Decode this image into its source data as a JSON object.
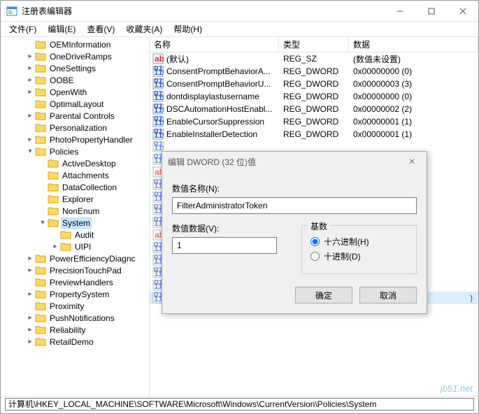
{
  "window": {
    "title": "注册表编辑器"
  },
  "menu": {
    "file": "文件(F)",
    "edit": "编辑(E)",
    "view": "查看(V)",
    "fav": "收藏夹(A)",
    "help": "帮助(H)"
  },
  "tree": [
    {
      "indent": 2,
      "label": "OEMInformation",
      "exp": ""
    },
    {
      "indent": 2,
      "label": "OneDriveRamps",
      "exp": ">"
    },
    {
      "indent": 2,
      "label": "OneSettings",
      "exp": ">"
    },
    {
      "indent": 2,
      "label": "OOBE",
      "exp": ">"
    },
    {
      "indent": 2,
      "label": "OpenWith",
      "exp": ">"
    },
    {
      "indent": 2,
      "label": "OptimalLayout",
      "exp": ""
    },
    {
      "indent": 2,
      "label": "Parental Controls",
      "exp": ">"
    },
    {
      "indent": 2,
      "label": "Personalization",
      "exp": ""
    },
    {
      "indent": 2,
      "label": "PhotoPropertyHandler",
      "exp": ">"
    },
    {
      "indent": 2,
      "label": "Policies",
      "exp": "v"
    },
    {
      "indent": 3,
      "label": "ActiveDesktop",
      "exp": ""
    },
    {
      "indent": 3,
      "label": "Attachments",
      "exp": ""
    },
    {
      "indent": 3,
      "label": "DataCollection",
      "exp": ""
    },
    {
      "indent": 3,
      "label": "Explorer",
      "exp": ""
    },
    {
      "indent": 3,
      "label": "NonEnum",
      "exp": ""
    },
    {
      "indent": 3,
      "label": "System",
      "exp": "v",
      "selected": true
    },
    {
      "indent": 4,
      "label": "Audit",
      "exp": ""
    },
    {
      "indent": 4,
      "label": "UIPI",
      "exp": ">"
    },
    {
      "indent": 2,
      "label": "PowerEfficiencyDiagnc",
      "exp": ">"
    },
    {
      "indent": 2,
      "label": "PrecisionTouchPad",
      "exp": ">"
    },
    {
      "indent": 2,
      "label": "PreviewHandlers",
      "exp": ""
    },
    {
      "indent": 2,
      "label": "PropertySystem",
      "exp": ">"
    },
    {
      "indent": 2,
      "label": "Proximity",
      "exp": ""
    },
    {
      "indent": 2,
      "label": "PushNotifications",
      "exp": ">"
    },
    {
      "indent": 2,
      "label": "Reliability",
      "exp": ">"
    },
    {
      "indent": 2,
      "label": "RetailDemo",
      "exp": ">"
    }
  ],
  "list": {
    "headers": {
      "name": "名称",
      "type": "类型",
      "data": "数据"
    },
    "rows": [
      {
        "icon": "sz",
        "name": "(默认)",
        "type": "REG_SZ",
        "data": "(数值未设置)"
      },
      {
        "icon": "dw",
        "name": "ConsentPromptBehaviorA...",
        "type": "REG_DWORD",
        "data": "0x00000000 (0)"
      },
      {
        "icon": "dw",
        "name": "ConsentPromptBehaviorU...",
        "type": "REG_DWORD",
        "data": "0x00000003 (3)"
      },
      {
        "icon": "dw",
        "name": "dontdisplaylastusername",
        "type": "REG_DWORD",
        "data": "0x00000000 (0)"
      },
      {
        "icon": "dw",
        "name": "DSCAutomationHostEnabl...",
        "type": "REG_DWORD",
        "data": "0x00000002 (2)"
      },
      {
        "icon": "dw",
        "name": "EnableCursorSuppression",
        "type": "REG_DWORD",
        "data": "0x00000001 (1)"
      },
      {
        "icon": "dw",
        "name": "EnableInstallerDetection",
        "type": "REG_DWORD",
        "data": "0x00000001 (1)"
      }
    ],
    "stubs": 13,
    "sel_tail": ")"
  },
  "dialog": {
    "title": "编辑 DWORD (32 位)值",
    "name_label": "数值名称(N):",
    "name_value": "FilterAdministratorToken",
    "data_label": "数值数据(V):",
    "data_value": "1",
    "base_label": "基数",
    "hex": "十六进制(H)",
    "dec": "十进制(D)",
    "ok": "确定",
    "cancel": "取消"
  },
  "status": {
    "path": "计算机\\HKEY_LOCAL_MACHINE\\SOFTWARE\\Microsoft\\Windows\\CurrentVersion\\Policies\\System"
  },
  "watermark": "jb51.net"
}
